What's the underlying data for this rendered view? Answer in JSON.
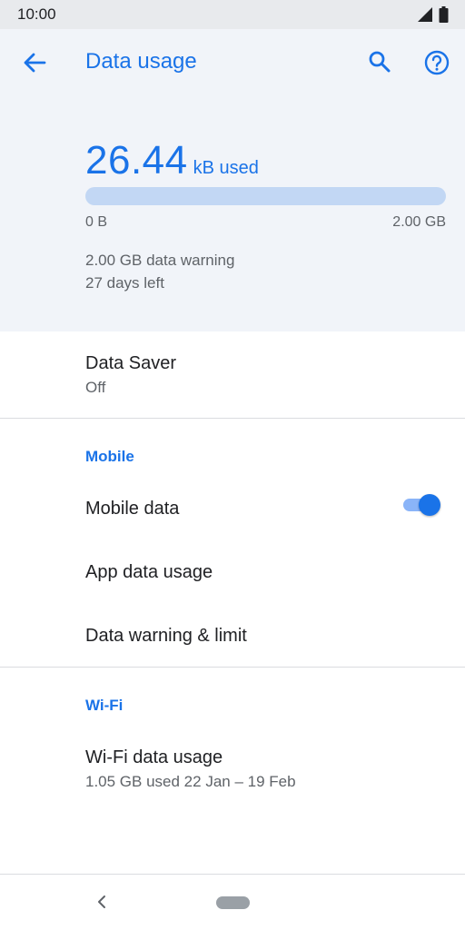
{
  "status_bar": {
    "time": "10:00"
  },
  "header": {
    "title": "Data usage"
  },
  "usage": {
    "amount": "26.44",
    "unit": "kB used",
    "fraction_used": 0.0,
    "range_min": "0 B",
    "range_max": "2.00 GB",
    "warning": "2.00 GB data warning",
    "days_left": "27 days left"
  },
  "data_saver": {
    "title": "Data Saver",
    "summary": "Off"
  },
  "mobile_section": {
    "header": "Mobile",
    "mobile_data": {
      "title": "Mobile data",
      "enabled": true
    },
    "app_data_usage": {
      "title": "App data usage"
    },
    "data_warning_limit": {
      "title": "Data warning & limit"
    }
  },
  "wifi_section": {
    "header": "Wi-Fi",
    "wifi_data_usage": {
      "title": "Wi-Fi data usage",
      "summary": "1.05 GB used 22 Jan – 19 Feb"
    }
  },
  "colors": {
    "accent": "#1a73e8",
    "progress_track": "#c2d7f4",
    "header_background": "#f1f4f9",
    "toggle_track": "#8ab4f8"
  },
  "icons": {
    "back": "arrow-left-icon",
    "search": "search-icon",
    "help": "help-circle-icon",
    "signal": "signal-icon",
    "battery": "battery-icon",
    "nav_back": "chevron-left-icon",
    "nav_home": "home-pill-icon"
  }
}
